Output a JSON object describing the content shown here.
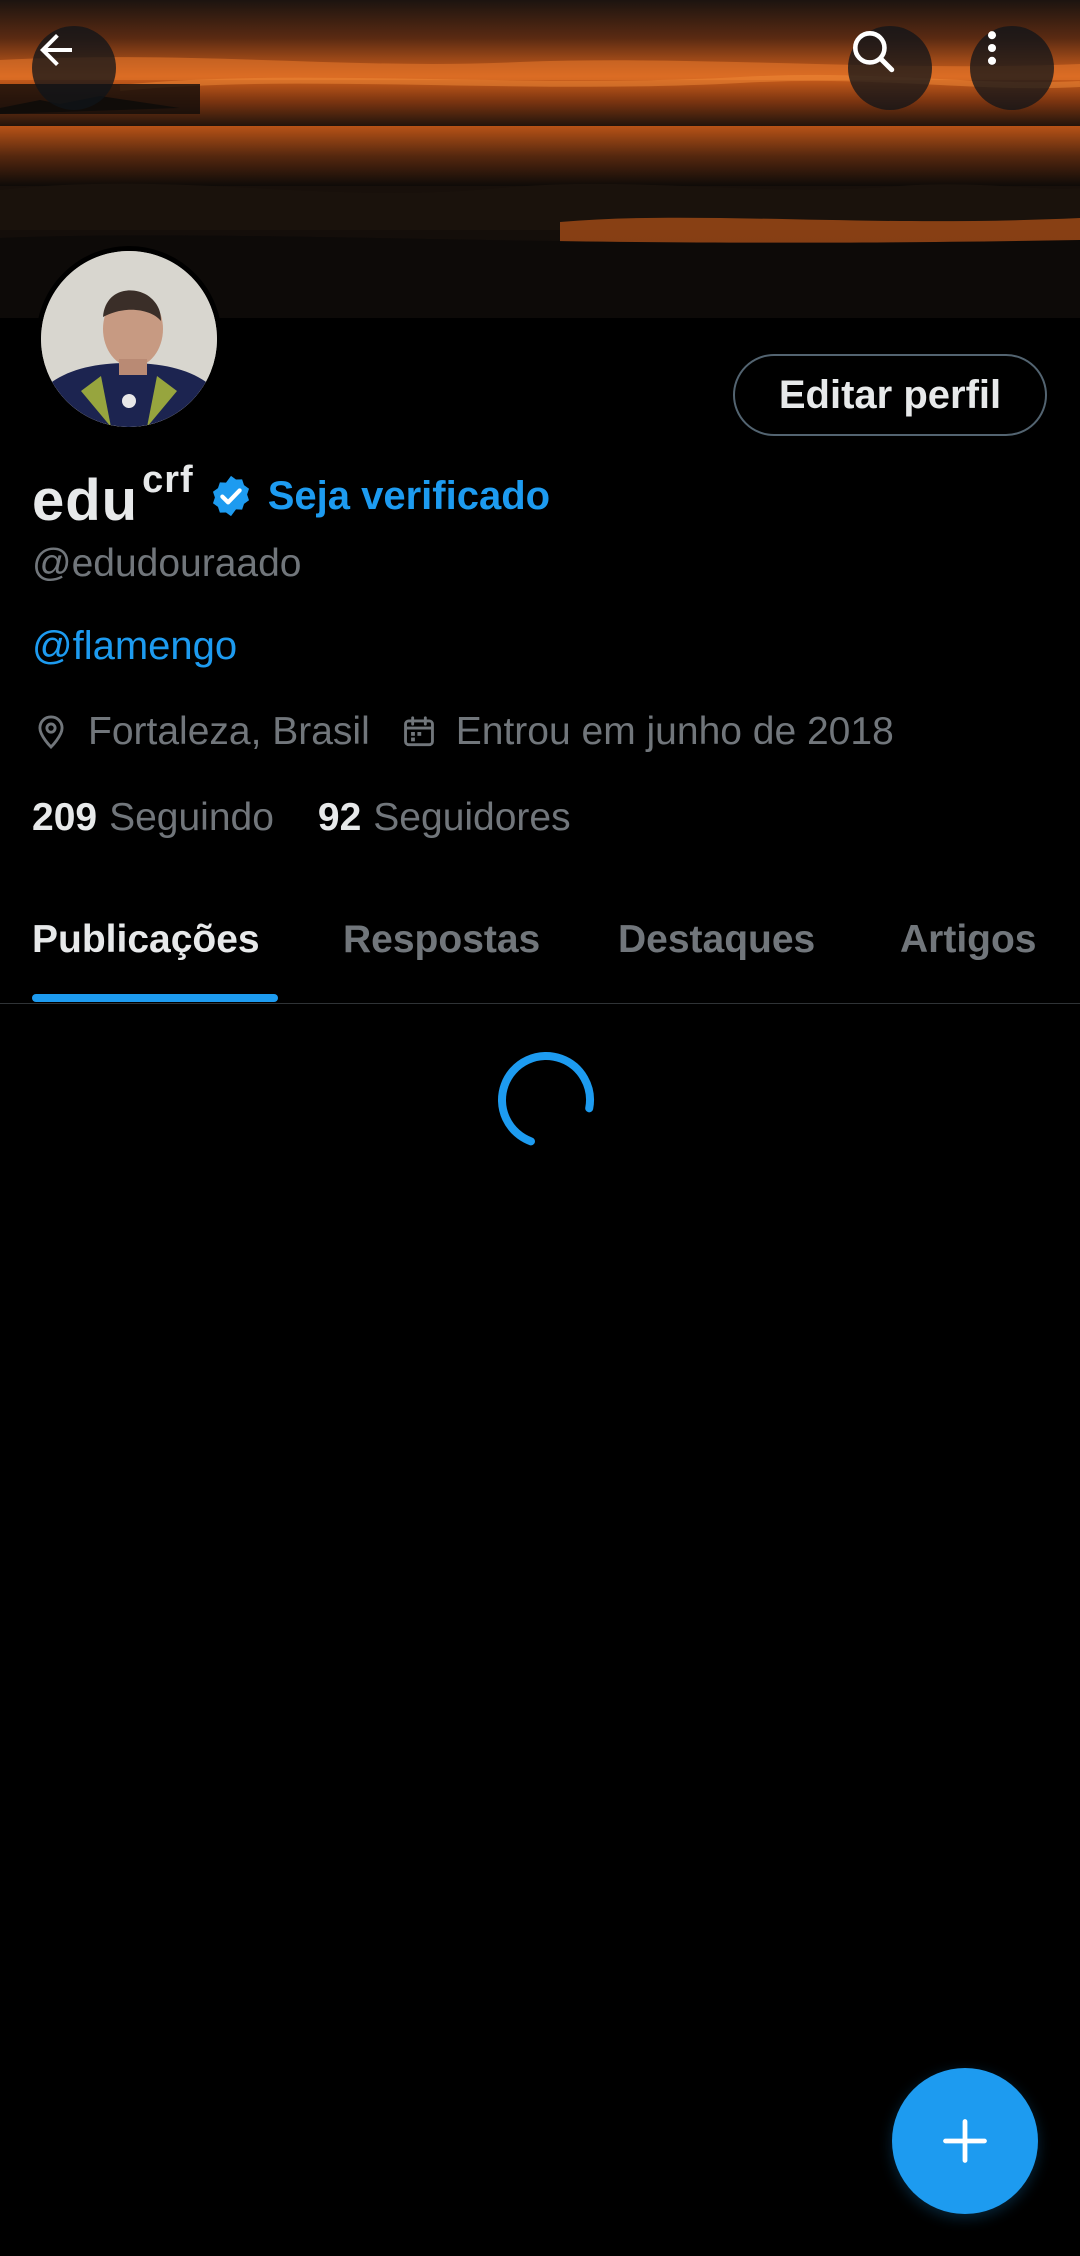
{
  "header": {
    "back_icon": "arrow-left-icon",
    "search_icon": "search-icon",
    "more_icon": "more-vertical-icon",
    "banner_description_icon": "sunset-beach-banner"
  },
  "profile": {
    "display_name": "edu",
    "name_superscript": "crf",
    "verified_icon": "verified-badge-icon",
    "verify_label": "Seja verificado",
    "handle": "@edudouraado",
    "bio": "@flamengo",
    "location": "Fortaleza, Brasil",
    "joined": "Entrou em junho de 2018",
    "edit_button": "Editar perfil",
    "following_count": "209",
    "following_label": "Seguindo",
    "followers_count": "92",
    "followers_label": "Seguidores"
  },
  "tabs": [
    {
      "label": "Publicações",
      "active": true
    },
    {
      "label": "Respostas",
      "active": false
    },
    {
      "label": "Destaques",
      "active": false
    },
    {
      "label": "Artigos",
      "active": false
    }
  ],
  "colors": {
    "accent": "#1d9bf0",
    "background": "#000000",
    "primary_text": "#e7e9ea",
    "secondary_text": "#71767b"
  },
  "fab": {
    "icon": "plus-icon"
  }
}
